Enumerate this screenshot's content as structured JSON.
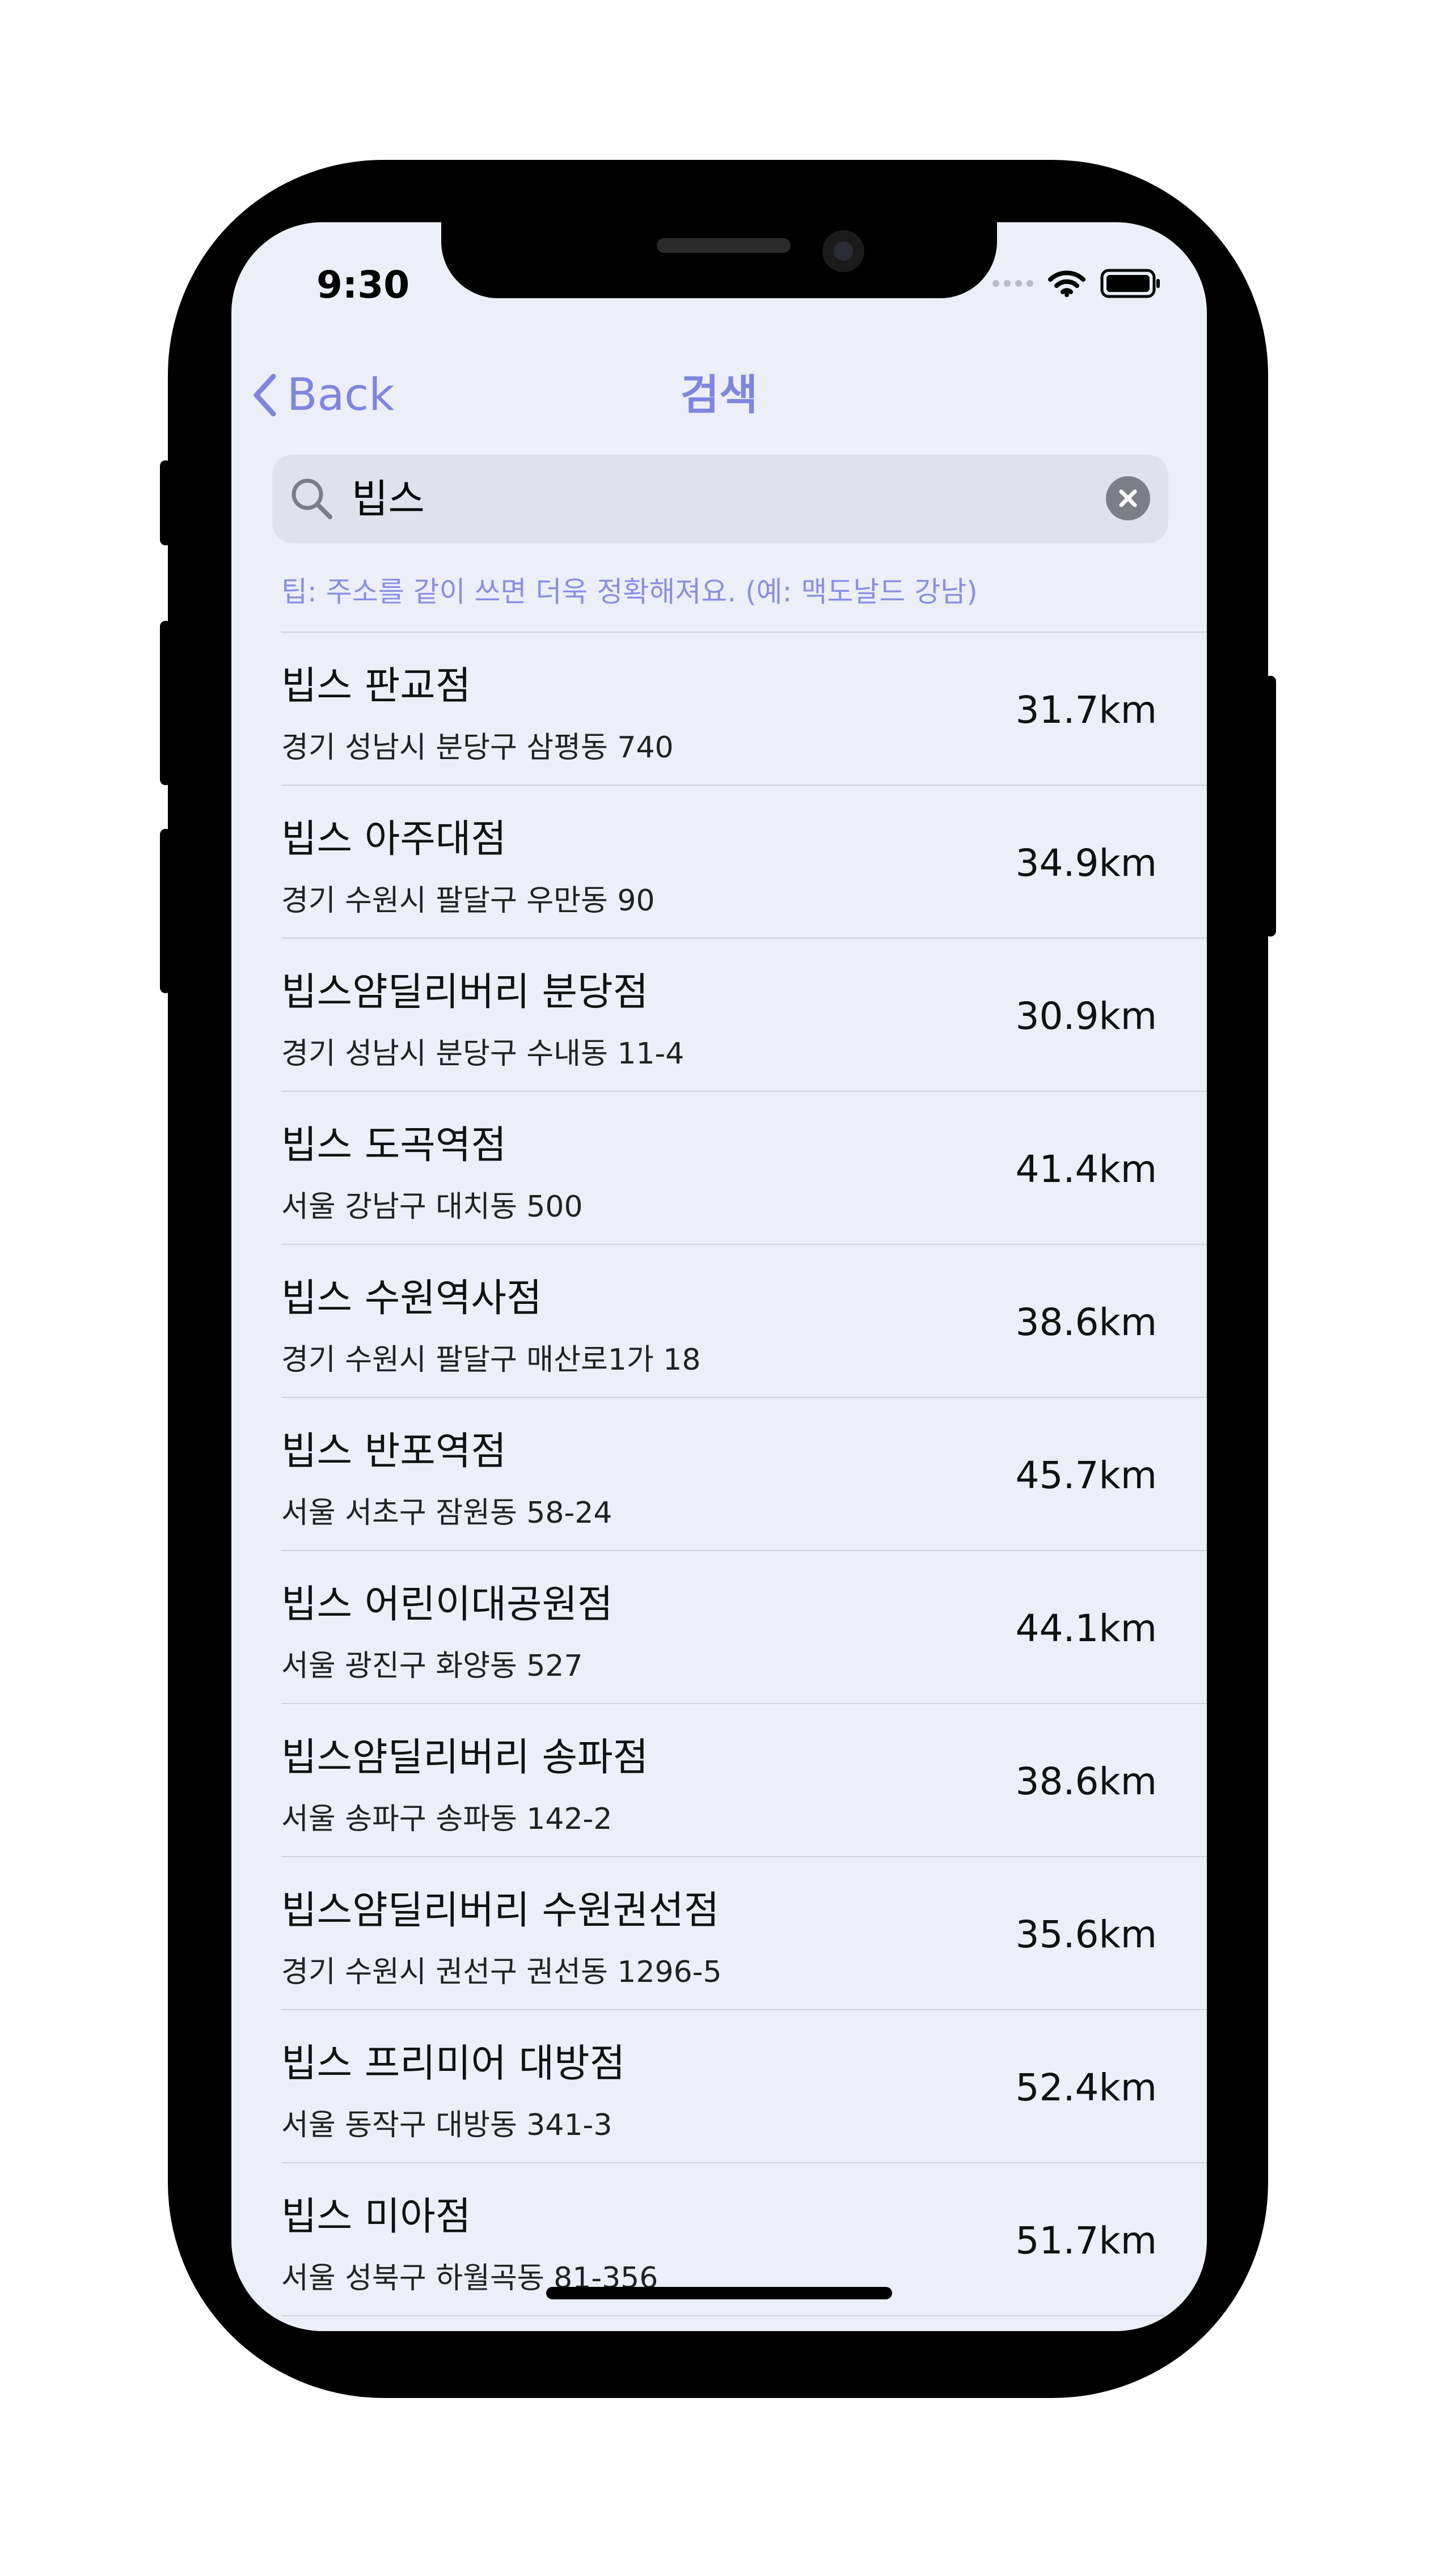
{
  "status": {
    "time": "9:30"
  },
  "nav": {
    "back_label": "Back",
    "title": "검색"
  },
  "search": {
    "value": "빕스",
    "placeholder": ""
  },
  "tip": "팁: 주소를 같이 쓰면 더욱 정확해져요. (예: 맥도날드 강남)",
  "results": [
    {
      "name": "빕스 판교점",
      "address": "경기 성남시 분당구 삼평동 740",
      "distance": "31.7km"
    },
    {
      "name": "빕스 아주대점",
      "address": "경기 수원시 팔달구 우만동 90",
      "distance": "34.9km"
    },
    {
      "name": "빕스얌딜리버리 분당점",
      "address": "경기 성남시 분당구 수내동 11-4",
      "distance": "30.9km"
    },
    {
      "name": "빕스 도곡역점",
      "address": "서울 강남구 대치동 500",
      "distance": "41.4km"
    },
    {
      "name": "빕스 수원역사점",
      "address": "경기 수원시 팔달구 매산로1가 18",
      "distance": "38.6km"
    },
    {
      "name": "빕스 반포역점",
      "address": "서울 서초구 잠원동 58-24",
      "distance": "45.7km"
    },
    {
      "name": "빕스 어린이대공원점",
      "address": "서울 광진구 화양동 527",
      "distance": "44.1km"
    },
    {
      "name": "빕스얌딜리버리 송파점",
      "address": "서울 송파구 송파동 142-2",
      "distance": "38.6km"
    },
    {
      "name": "빕스얌딜리버리 수원권선점",
      "address": "경기 수원시 권선구 권선동 1296-5",
      "distance": "35.6km"
    },
    {
      "name": "빕스 프리미어 대방점",
      "address": "서울 동작구 대방동 341-3",
      "distance": "52.4km"
    },
    {
      "name": "빕스 미아점",
      "address": "서울 성북구 하월곡동 81-356",
      "distance": "51.7km"
    }
  ],
  "colors": {
    "accent": "#7e86e0",
    "background": "#eceff8",
    "search_field": "#dfe1eb"
  }
}
